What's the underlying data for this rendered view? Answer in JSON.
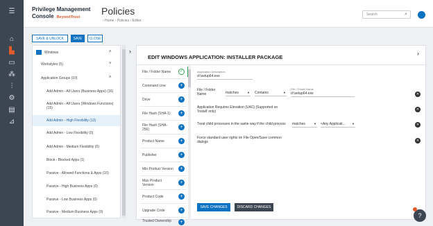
{
  "header": {
    "brand_line1": "Privilege Management",
    "brand_line2": "Console",
    "brand_mark": "BeyondTrust",
    "page_title": "Policies",
    "breadcrumb": "›  Home  ›  Policies  ›  Editor",
    "search_placeholder": "Search",
    "search_icon": "search-icon",
    "user_icon": "user-icon"
  },
  "rail_icons": [
    "menu-icon",
    "home-icon",
    "policy-icon",
    "monitor-icon",
    "hierarchy-icon",
    "analytics-icon",
    "settings-icon",
    "file-icon",
    "reports-icon"
  ],
  "toolbar": {
    "save_unlock": "SAVE & UNLOCK",
    "save": "SAVE",
    "close": "CLOSE"
  },
  "tree": {
    "root": "Windows",
    "items": [
      {
        "label": "Workstyles (5)",
        "level": 1,
        "chevron": "˅"
      },
      {
        "label": "Application Groups (10)",
        "level": 1,
        "chevron": "˄"
      },
      {
        "label": "Add Admin - All Users (Business Apps) (16)",
        "level": 2
      },
      {
        "label": "Add Admin - All Users (Windows Functions) (15)",
        "level": 2
      },
      {
        "label": "Add Admin - High Flexibility (13)",
        "level": 2,
        "selected": true
      },
      {
        "label": "Add Admin - Low Flexibility (0)",
        "level": 2
      },
      {
        "label": "Add Admin - Medium Flexibility (0)",
        "level": 2
      },
      {
        "label": "Block - Blocked Apps (1)",
        "level": 2
      },
      {
        "label": "Passive - Allowed Functions & Apps (10)",
        "level": 2
      },
      {
        "label": "Passive - High Business Apps (0)",
        "level": 2
      },
      {
        "label": "Passive - Low Business Apps (0)",
        "level": 2
      },
      {
        "label": "Passive - Medium Business Apps (0)",
        "level": 2
      }
    ]
  },
  "editor": {
    "title": "EDIT WINDOWS APPLICATION: INSTALLER PACKAGE",
    "match_criteria": [
      {
        "label": "File / Folder Name",
        "state": "checked"
      },
      {
        "label": "Command Line"
      },
      {
        "label": "Drive"
      },
      {
        "label": "File Hash (SHA-1)"
      },
      {
        "label": "File Hash (SHA-256)"
      },
      {
        "label": "Product Name"
      },
      {
        "label": "Publisher"
      },
      {
        "label": "Min Product Version"
      },
      {
        "label": "Max Product Version"
      },
      {
        "label": "Product Code"
      },
      {
        "label": "Upgrade Code"
      },
      {
        "label": "Trusted Ownership"
      }
    ],
    "app_desc_label": "Application Description",
    "app_desc_value": "d:\\setup64.exe",
    "file_folder_label": "File / Folder Name",
    "match_select": "matches",
    "contains_select": "Contains",
    "file_name_small_label": "File / Folder Name",
    "file_name_value": "d:\\setup64.exe",
    "elevation_text": "Application Requires Elevation (UAC) (Supported on 'Install' only)",
    "child_text": "Treat child processes in the same way if the child process",
    "child_match_select": "matches",
    "child_app_select": "<Any Applicati...",
    "force_text": "Force standard user rights on File Open/Save common dialogs",
    "save_changes": "SAVE CHANGES",
    "discard_changes": "DISCARD CHANGES"
  },
  "help_icon": "help-icon"
}
